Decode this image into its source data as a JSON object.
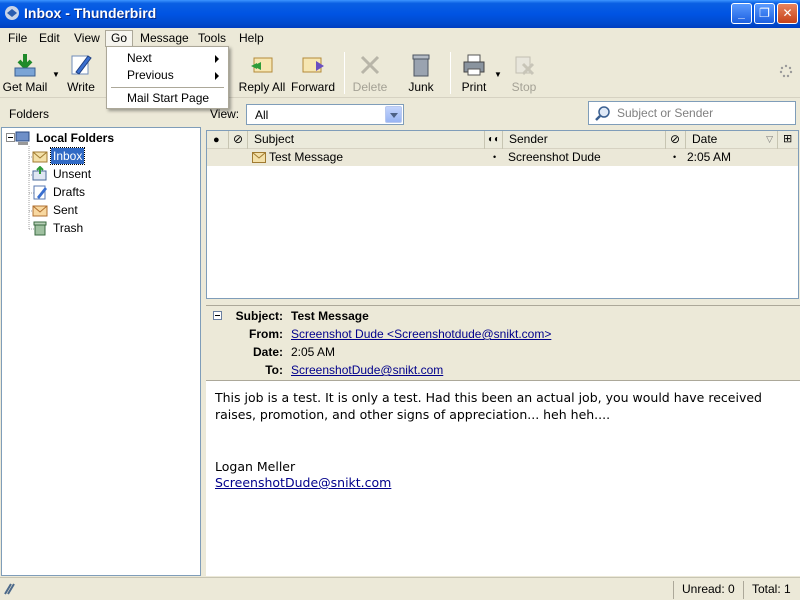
{
  "window": {
    "title": "Inbox - Thunderbird"
  },
  "menu": {
    "file": "File",
    "edit": "Edit",
    "view": "View",
    "go": "Go",
    "message": "Message",
    "tools": "Tools",
    "help": "Help"
  },
  "go_menu": {
    "next": "Next",
    "previous": "Previous",
    "start_page": "Mail Start Page"
  },
  "toolbar": {
    "get_mail": "Get Mail",
    "write": "Write",
    "reply_all": "Reply All",
    "forward": "Forward",
    "delete": "Delete",
    "junk": "Junk",
    "print": "Print",
    "stop": "Stop"
  },
  "folders_label": "Folders",
  "view_filter": {
    "label": "View:",
    "value": "All"
  },
  "search": {
    "placeholder": "Subject or Sender"
  },
  "folder_tree": {
    "root": "Local Folders",
    "items": [
      "Inbox",
      "Unsent",
      "Drafts",
      "Sent",
      "Trash"
    ],
    "selected": "Inbox"
  },
  "thread_columns": {
    "subject": "Subject",
    "sender": "Sender",
    "date": "Date"
  },
  "messages": [
    {
      "subject": "Test Message",
      "sender": "Screenshot Dude",
      "date": "2:05 AM"
    }
  ],
  "message_header": {
    "subject_label": "Subject:",
    "subject": "Test Message",
    "from_label": "From:",
    "from": "Screenshot Dude <Screenshotdude@snikt.com>",
    "date_label": "Date:",
    "date": "2:05 AM",
    "to_label": "To:",
    "to": "ScreenshotDude@snikt.com"
  },
  "message_body": {
    "text": "This job is a test.  It is only a test.  Had this been an actual job, you would have received raises, promotion, and other signs of appreciation... heh heh....",
    "signature_name": "Logan Meller",
    "signature_email": "ScreenshotDude@snikt.com"
  },
  "status": {
    "unread": "Unread: 0",
    "total": "Total: 1"
  },
  "colors": {
    "titlebar": "#0054e3",
    "selection": "#316ac5",
    "link": "#00008b",
    "chrome": "#ece9d8"
  }
}
